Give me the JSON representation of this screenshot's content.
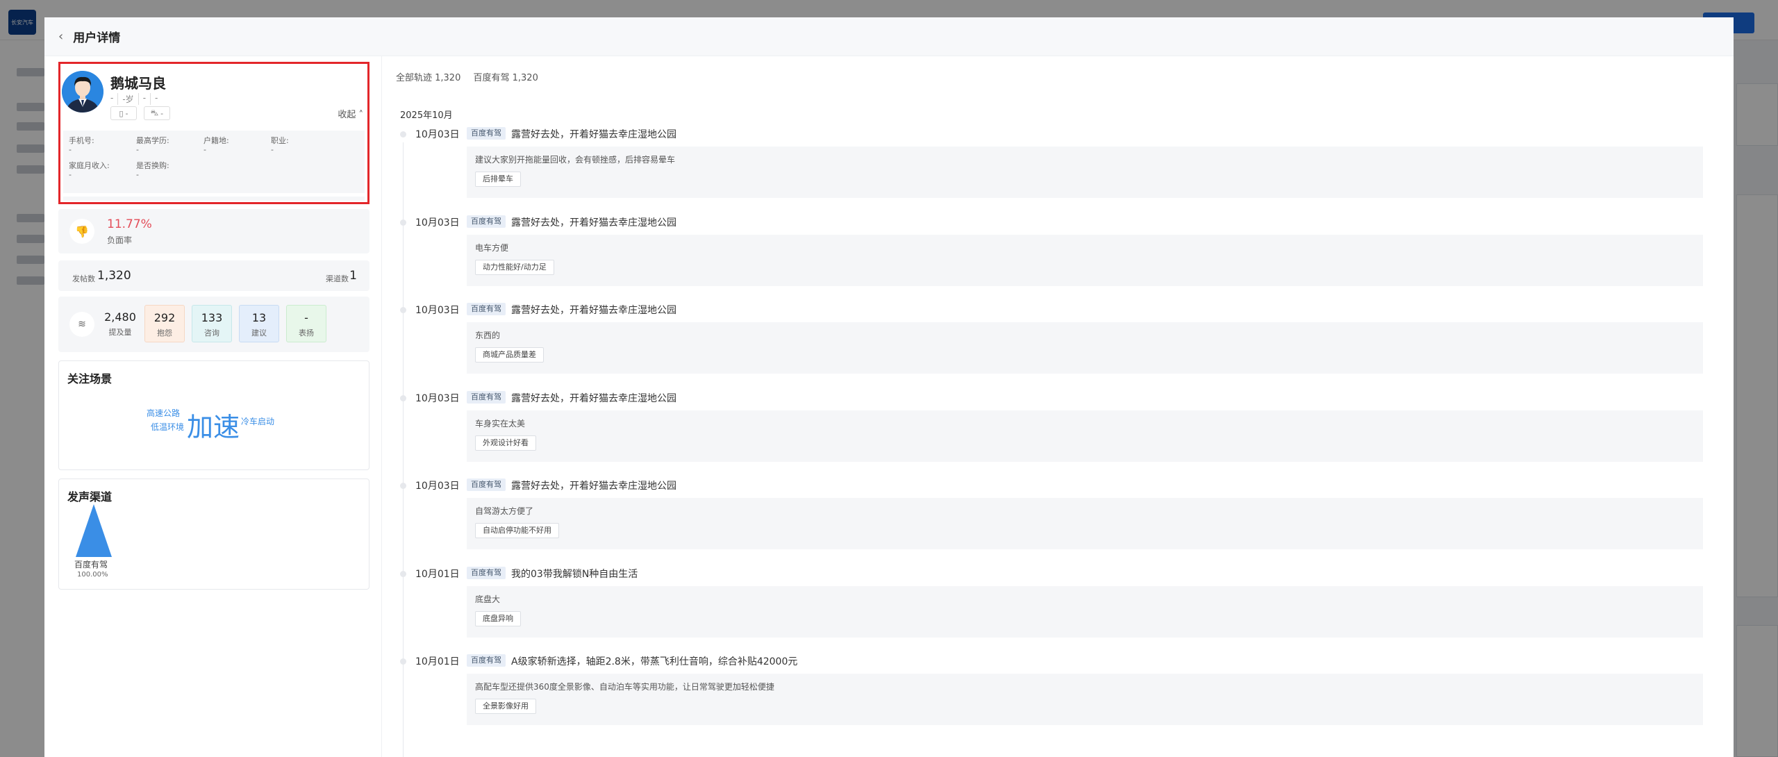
{
  "app": {
    "logo_text": "长安汽车"
  },
  "modal": {
    "title": "用户详情",
    "back_icon": "chevron-left-icon"
  },
  "profile": {
    "name": "鹅城马良",
    "tags": [
      "-",
      "-岁",
      "-",
      "-"
    ],
    "chip1_value": "-",
    "chip2_value": "-",
    "collapse_label": "收起",
    "fields_row1": [
      {
        "label": "手机号:",
        "value": "-"
      },
      {
        "label": "最高学历:",
        "value": "-"
      },
      {
        "label": "户籍地:",
        "value": "-"
      },
      {
        "label": "职业:",
        "value": "-"
      }
    ],
    "fields_row2": [
      {
        "label": "家庭月收入:",
        "value": "-"
      },
      {
        "label": "是否换购:",
        "value": "-"
      }
    ]
  },
  "stats": {
    "negative_rate": "11.77%",
    "negative_label": "负面率",
    "post_label": "发帖数",
    "post_count": "1,320",
    "channel_label": "渠道数",
    "channel_count": "1",
    "mentions": {
      "value": "2,480",
      "label": "提及量"
    },
    "metrics": [
      {
        "value": "292",
        "label": "抱怨",
        "color": "#fdeee4"
      },
      {
        "value": "133",
        "label": "咨询",
        "color": "#e4f5f6"
      },
      {
        "value": "13",
        "label": "建议",
        "color": "#e4eefb"
      },
      {
        "value": "-",
        "label": "表扬",
        "color": "#e8f7ea"
      }
    ]
  },
  "focus_scenes": {
    "title": "关注场景",
    "words": {
      "w1": "高速公路",
      "w2": "低温环境",
      "w3": "加速",
      "w4": "冷车启动"
    }
  },
  "voice_channels": {
    "title": "发声渠道",
    "channel_name": "百度有驾",
    "channel_pct": "100.00%",
    "share": 1.0
  },
  "timeline": {
    "filter_all": "全部轨迹 1,320",
    "filter_baidu": "百度有驾 1,320",
    "month": "2025年10月",
    "items": [
      {
        "date": "10月03日",
        "badge": "百度有驾",
        "title": "露营好去处，开着好猫去幸庄湿地公园",
        "text": "建议大家别开拖能量回收，会有顿挫感，后排容易晕车",
        "tag": "后排晕车"
      },
      {
        "date": "10月03日",
        "badge": "百度有驾",
        "title": "露营好去处，开着好猫去幸庄湿地公园",
        "text": "电车方便",
        "tag": "动力性能好/动力足"
      },
      {
        "date": "10月03日",
        "badge": "百度有驾",
        "title": "露营好去处，开着好猫去幸庄湿地公园",
        "text": "东西的",
        "tag": "商城产品质量差"
      },
      {
        "date": "10月03日",
        "badge": "百度有驾",
        "title": "露营好去处，开着好猫去幸庄湿地公园",
        "text": "车身实在太美",
        "tag": "外观设计好看"
      },
      {
        "date": "10月03日",
        "badge": "百度有驾",
        "title": "露营好去处，开着好猫去幸庄湿地公园",
        "text": "自驾游太方便了",
        "tag": "自动启停功能不好用"
      },
      {
        "date": "10月01日",
        "badge": "百度有驾",
        "title": "我的03带我解锁N种自由生活",
        "text": "底盘大",
        "tag": "底盘异响"
      },
      {
        "date": "10月01日",
        "badge": "百度有驾",
        "title": "A级家轿新选择，轴距2.8米，带蒸飞利仕音响，综合补贴42000元",
        "text": "高配车型还提供360度全景影像、自动泊车等实用功能，让日常驾驶更加轻松便捷",
        "tag": "全景影像好用"
      }
    ]
  }
}
